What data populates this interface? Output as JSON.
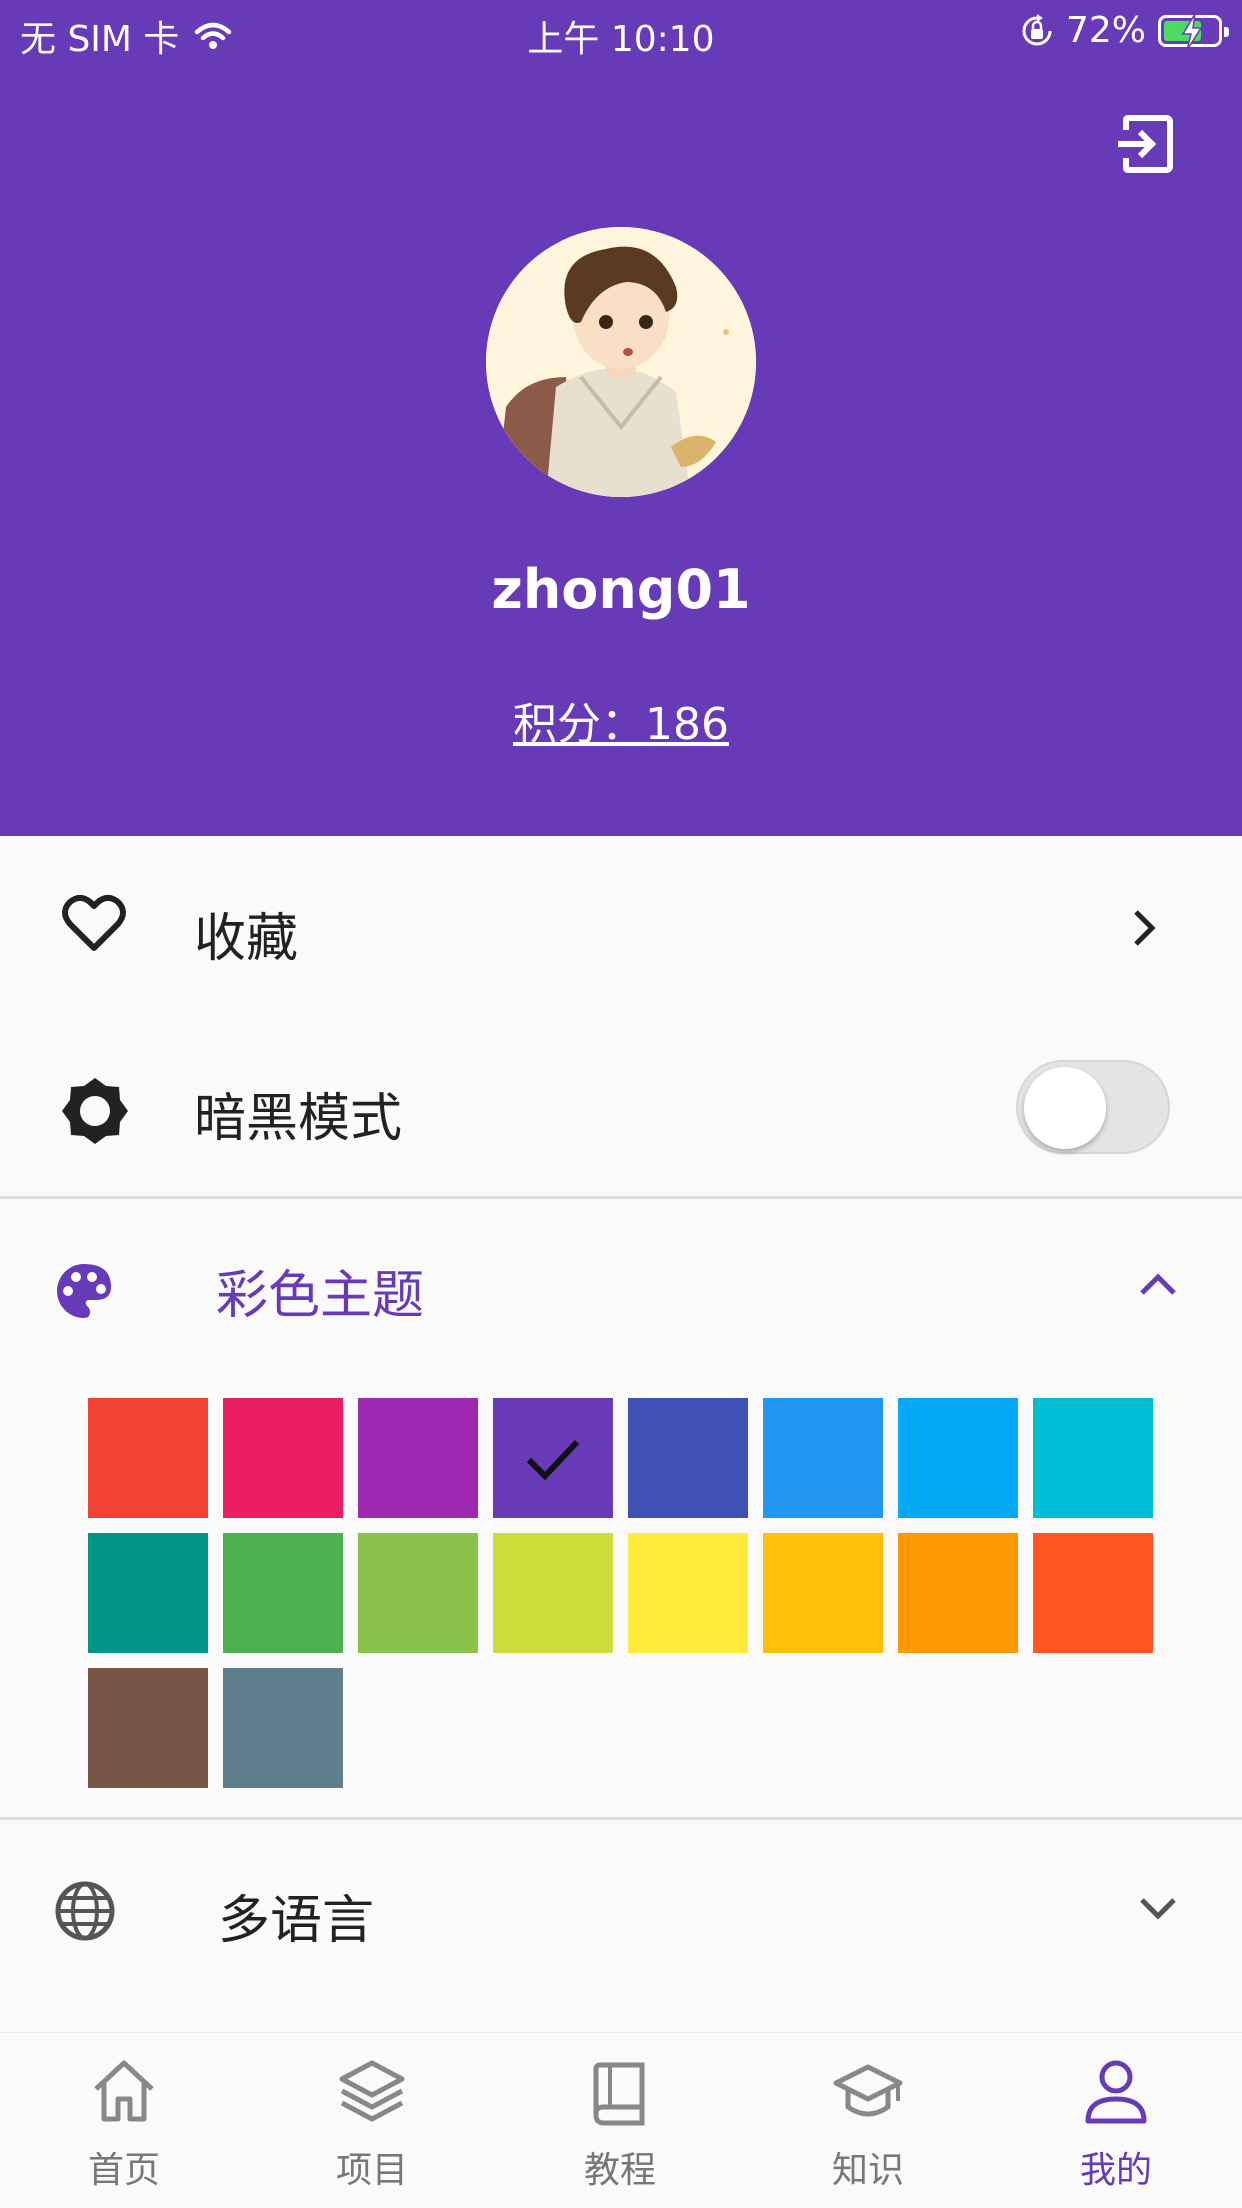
{
  "status_bar": {
    "carrier": "无 SIM 卡",
    "time": "上午 10:10",
    "battery": "72%",
    "battery_level": 0.72
  },
  "profile": {
    "username": "zhong01",
    "points": "积分：186"
  },
  "menu": {
    "favorites": {
      "label": "收藏",
      "icon": "heart-icon"
    },
    "dark_mode": {
      "label": "暗黑模式",
      "icon": "brightness-icon",
      "enabled": false
    },
    "color_theme": {
      "label": "彩色主题",
      "icon": "palette-icon",
      "accent": "#673ab7",
      "selected": "#673ab7",
      "colors": [
        "#f44336",
        "#e91e63",
        "#9c27b0",
        "#673ab7",
        "#3f51b5",
        "#2196f3",
        "#03a9f4",
        "#00bcd4",
        "#009688",
        "#4caf50",
        "#8bc34a",
        "#cddc39",
        "#ffeb3b",
        "#ffc107",
        "#ff9800",
        "#ff5722",
        "#795548",
        "#607d8b"
      ]
    },
    "language": {
      "label": "多语言",
      "icon": "globe-icon"
    }
  },
  "nav": {
    "active_color": "#673ab7",
    "items": [
      {
        "label": "首页",
        "icon": "home-icon"
      },
      {
        "label": "项目",
        "icon": "layers-icon"
      },
      {
        "label": "教程",
        "icon": "book-icon"
      },
      {
        "label": "知识",
        "icon": "school-icon"
      },
      {
        "label": "我的",
        "icon": "person-icon"
      }
    ]
  }
}
